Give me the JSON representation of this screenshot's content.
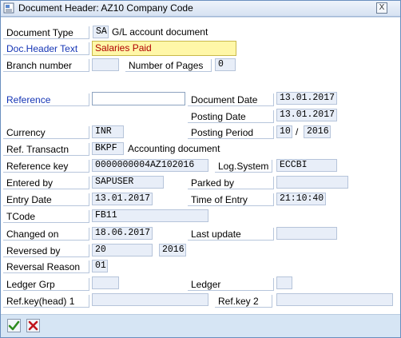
{
  "window": {
    "title": "Document Header: AZ10 Company Code",
    "close_label": "X"
  },
  "fields": {
    "document_type": {
      "label": "Document Type",
      "value": "SA",
      "text": "G/L account document"
    },
    "doc_header_text": {
      "label": "Doc.Header Text",
      "value": "Salaries Paid"
    },
    "branch_number": {
      "label": "Branch number",
      "value": ""
    },
    "number_of_pages": {
      "label": "Number of Pages",
      "value": "0"
    },
    "reference": {
      "label": "Reference",
      "value": ""
    },
    "document_date": {
      "label": "Document Date",
      "value": "13.01.2017"
    },
    "posting_date": {
      "label": "Posting Date",
      "value": "13.01.2017"
    },
    "currency": {
      "label": "Currency",
      "value": "INR"
    },
    "posting_period": {
      "label": "Posting Period",
      "period": "10",
      "separator": "/",
      "year": "2016"
    },
    "ref_transaction": {
      "label": "Ref. Transactn",
      "value": "BKPF",
      "text": "Accounting document"
    },
    "reference_key": {
      "label": "Reference key",
      "value": "0000000004AZ102016"
    },
    "log_system": {
      "label": "Log.System",
      "value": "ECCBI"
    },
    "entered_by": {
      "label": "Entered by",
      "value": "SAPUSER"
    },
    "parked_by": {
      "label": "Parked by",
      "value": ""
    },
    "entry_date": {
      "label": "Entry Date",
      "value": "13.01.2017"
    },
    "time_of_entry": {
      "label": "Time of Entry",
      "value": "21:10:40"
    },
    "tcode": {
      "label": "TCode",
      "value": "FB11"
    },
    "changed_on": {
      "label": "Changed on",
      "value": "18.06.2017"
    },
    "last_update": {
      "label": "Last update",
      "value": ""
    },
    "reversed_by": {
      "label": "Reversed by",
      "value": "20",
      "year": "2016"
    },
    "reversal_reason": {
      "label": "Reversal Reason",
      "value": "01"
    },
    "ledger_grp": {
      "label": "Ledger Grp",
      "value": ""
    },
    "ledger": {
      "label": "Ledger",
      "value": ""
    },
    "ref_key_head_1": {
      "label": "Ref.key(head) 1",
      "value": ""
    },
    "ref_key_2": {
      "label": "Ref.key 2",
      "value": ""
    }
  },
  "footer": {
    "confirm_icon": "check-icon",
    "cancel_icon": "cancel-x-icon"
  },
  "colors": {
    "link": "#1535b5",
    "highlight_bg": "#fff7a8",
    "highlight_text": "#b00000",
    "readonly_bg": "#e8eef8",
    "footer_bg": "#d6e5f4"
  }
}
